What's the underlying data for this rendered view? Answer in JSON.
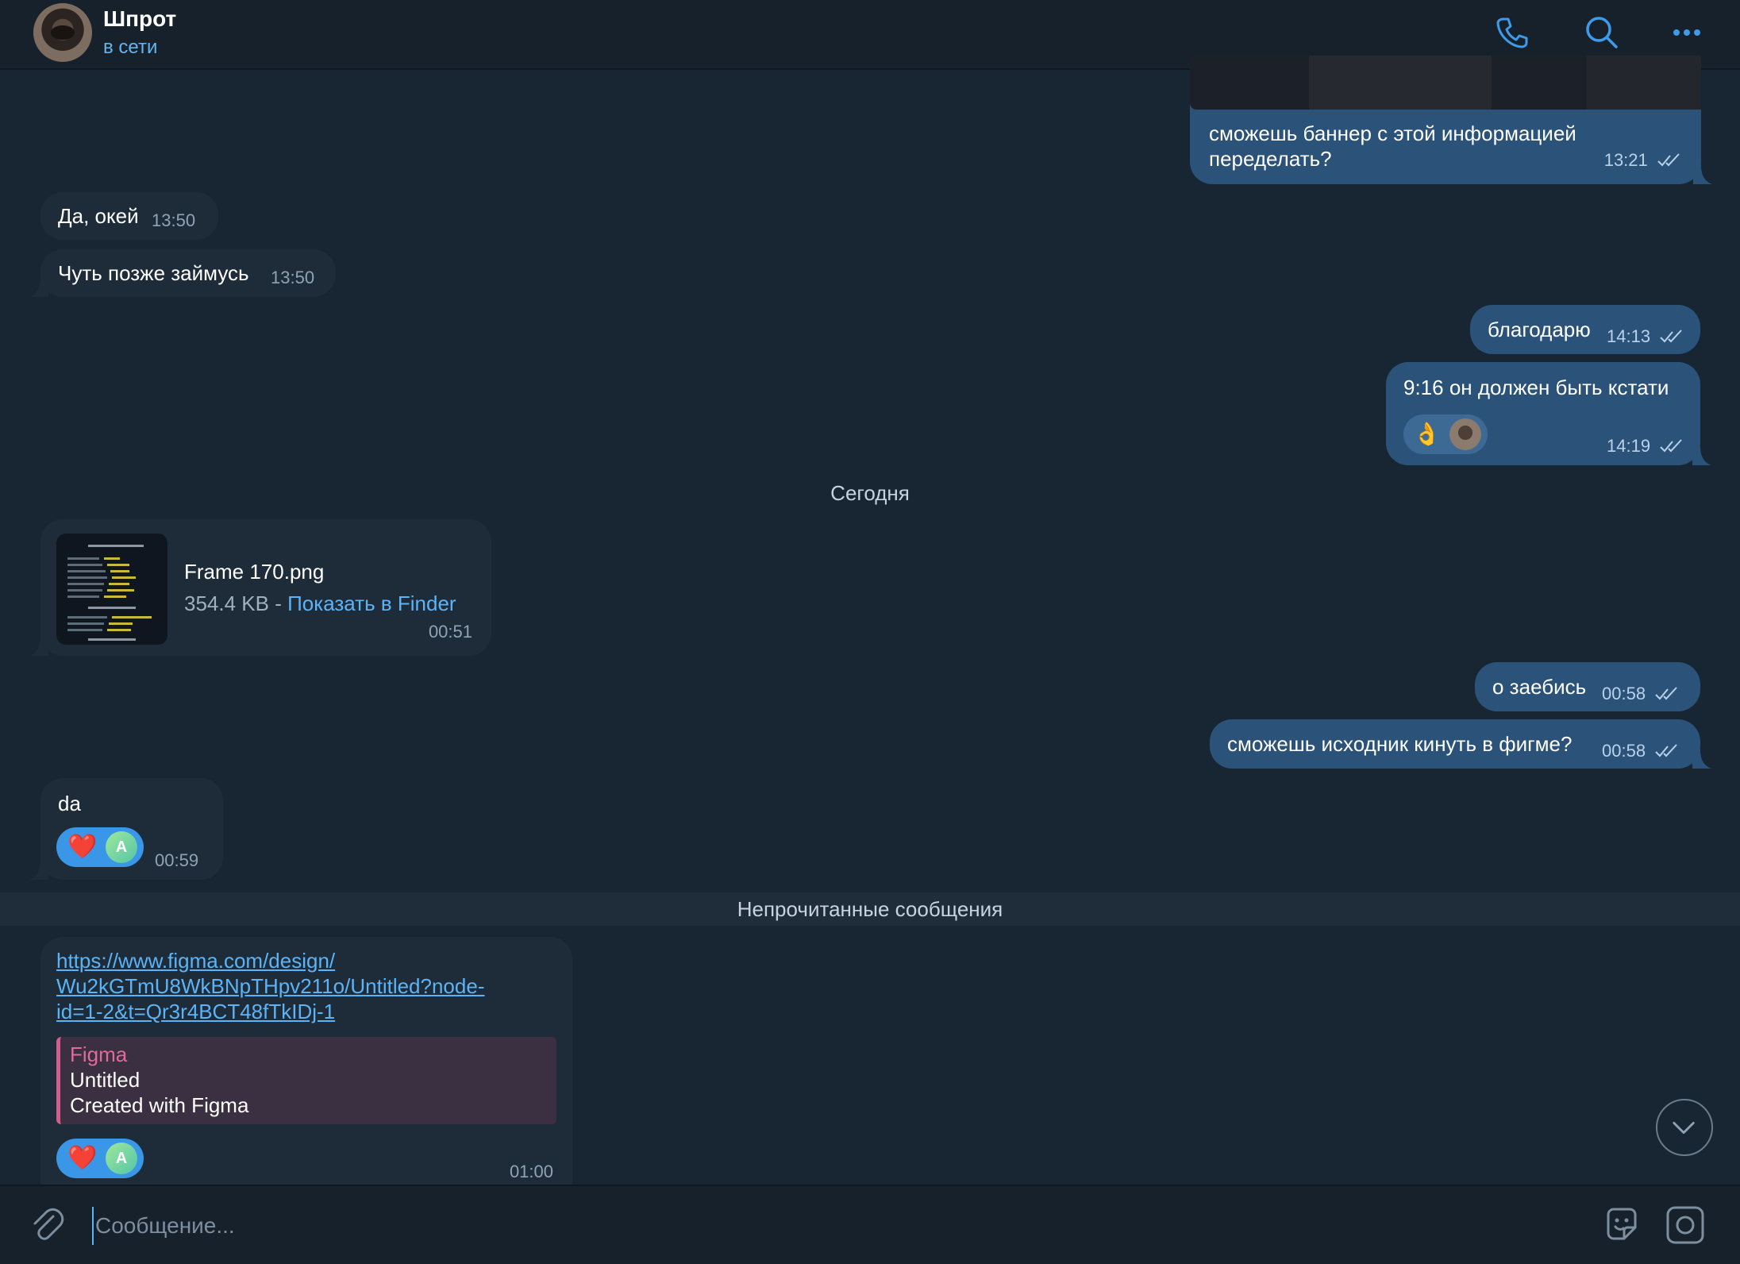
{
  "header": {
    "name": "Шпрот",
    "status": "в сети"
  },
  "messages": [
    {
      "text": "сможешь баннер с этой информацией переделать?",
      "time": "13:21",
      "direction": "out"
    },
    {
      "text": "Да, окей",
      "time": "13:50",
      "direction": "in"
    },
    {
      "text": "Чуть позже займусь",
      "time": "13:50",
      "direction": "in"
    },
    {
      "text": "благодарю",
      "time": "14:13",
      "direction": "out"
    },
    {
      "text": "9:16 он должен быть кстати",
      "time": "14:19",
      "direction": "out",
      "reaction": "👌"
    },
    {
      "text": "о заебись",
      "time": "00:58",
      "direction": "out"
    },
    {
      "text": "сможешь исходник кинуть в фигме?",
      "time": "00:58",
      "direction": "out"
    },
    {
      "text": "da",
      "time": "00:59",
      "direction": "in",
      "reaction": "❤️",
      "reactor": "A"
    }
  ],
  "date_separator": "Сегодня",
  "file": {
    "name": "Frame 170.png",
    "size": "354.4 KB -",
    "action": "Показать в Finder",
    "time": "00:51"
  },
  "unread_label": "Непрочитанные сообщения",
  "link_message": {
    "url_line1": "https://www.figma.com/design/",
    "url_line2": "Wu2kGTmU8WkBNpTHpv211o/Untitled?node-",
    "url_line3": "id=1-2&t=Qr3r4BCT48fTkIDj-1",
    "preview_site": "Figma",
    "preview_title": "Untitled",
    "preview_desc": "Created with Figma",
    "time": "01:00",
    "reaction": "❤️",
    "reactor": "A"
  },
  "composer": {
    "placeholder": "Сообщение..."
  },
  "icons": [
    "phone-icon",
    "search-icon",
    "more-icon",
    "paperclip-icon",
    "sticker-icon",
    "camera-icon",
    "chevron-down-icon"
  ],
  "colors": {
    "background": "#182533",
    "outgoing_bubble": "#2b5278",
    "incoming_bubble": "#1e2c3a",
    "accent": "#5cb3f5",
    "preview_accent": "#d45b8e"
  }
}
